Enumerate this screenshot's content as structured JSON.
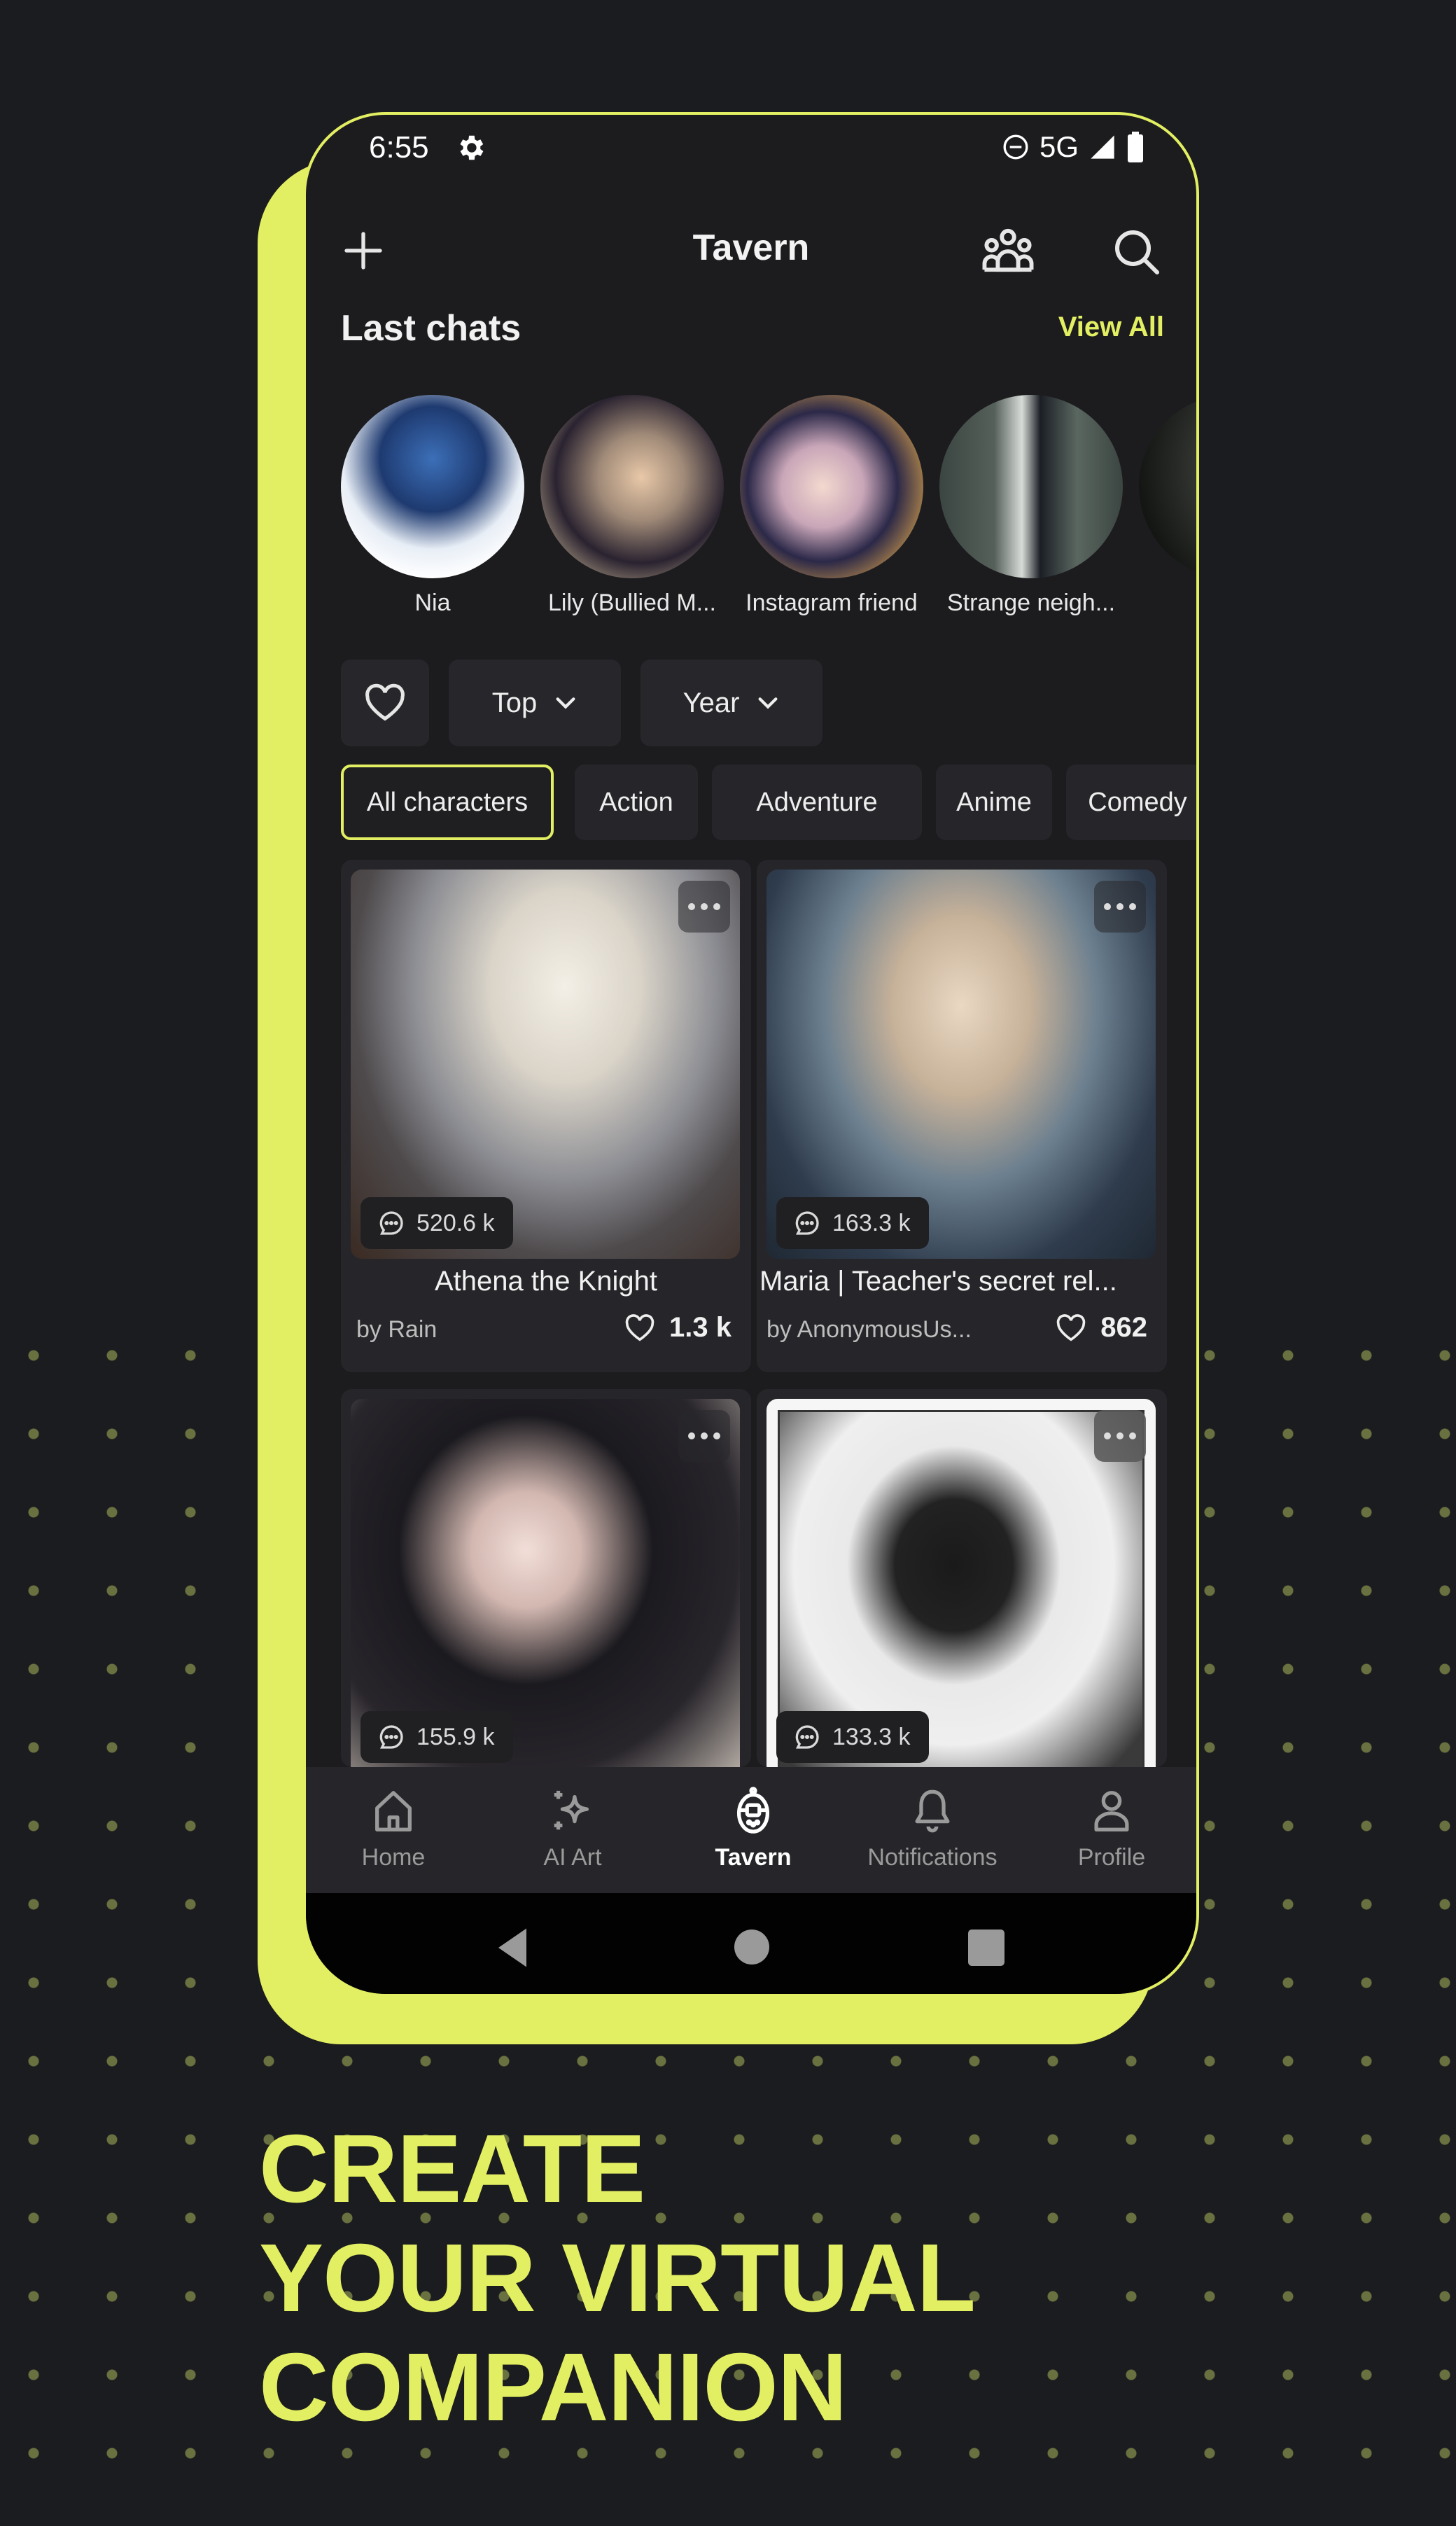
{
  "colors": {
    "accent": "#e3ef62",
    "background": "#1b1c1f",
    "surface": "#26262a",
    "dot": "#6a7140"
  },
  "status_bar": {
    "time": "6:55",
    "network": "5G",
    "icons": [
      "settings-gear-icon",
      "do-not-disturb-icon",
      "signal-icon",
      "battery-icon"
    ]
  },
  "top_bar": {
    "title": "Tavern",
    "left_icon": "plus-icon",
    "right_icons": [
      "group-icon",
      "search-icon"
    ]
  },
  "last_chats": {
    "heading": "Last chats",
    "view_all": "View All",
    "items": [
      {
        "name": "Nia"
      },
      {
        "name": "Lily (Bullied M..."
      },
      {
        "name": "Instagram friend"
      },
      {
        "name": "Strange neigh..."
      }
    ]
  },
  "filters": {
    "favorites_icon": "heart-outline-icon",
    "sort": {
      "selected": "Top"
    },
    "period": {
      "selected": "Year"
    }
  },
  "categories": {
    "active": "All characters",
    "items": [
      "All characters",
      "Action",
      "Adventure",
      "Anime",
      "Comedy"
    ]
  },
  "cards": [
    {
      "title": "Athena the Knight",
      "author": "by Rain",
      "chats": "520.6 k",
      "likes": "1.3 k"
    },
    {
      "title": "Maria | Teacher's secret rel...",
      "author": "by AnonymousUs...",
      "chats": "163.3 k",
      "likes": "862"
    },
    {
      "title": "",
      "author": "",
      "chats": "155.9 k",
      "likes": ""
    },
    {
      "title": "",
      "author": "",
      "chats": "133.3 k",
      "likes": ""
    }
  ],
  "bottom_nav": {
    "active": "Tavern",
    "items": [
      {
        "label": "Home",
        "icon": "home-icon"
      },
      {
        "label": "AI Art",
        "icon": "sparkle-icon"
      },
      {
        "label": "Tavern",
        "icon": "tavern-device-icon"
      },
      {
        "label": "Notifications",
        "icon": "bell-icon"
      },
      {
        "label": "Profile",
        "icon": "person-icon"
      }
    ]
  },
  "system_nav": [
    "back-icon",
    "home-circle-icon",
    "recents-square-icon"
  ],
  "promo": {
    "line1": "CREATE",
    "line2": "YOUR VIRTUAL",
    "line3": "COMPANION"
  }
}
